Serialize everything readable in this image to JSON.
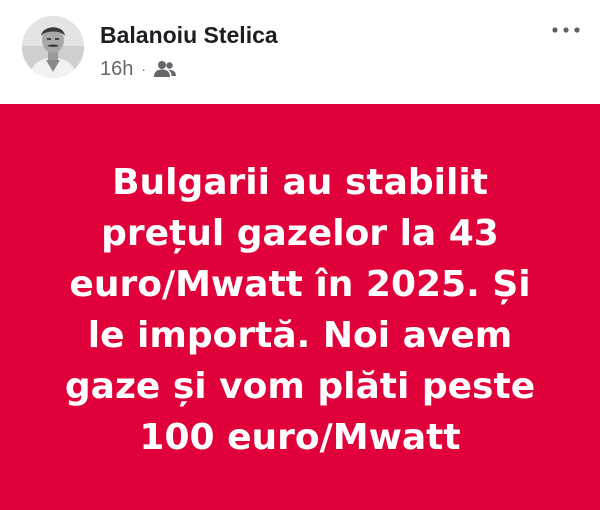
{
  "post": {
    "author": "Balanoiu Stelica",
    "time": "16h",
    "separator": "·",
    "audience_icon": "friends-icon",
    "more_icon": "more-horizontal-icon",
    "background_color": "#e0003a",
    "text_lines": [
      "Bulgarii au stabilit",
      "prețul gazelor la 43",
      "euro/Mwatt în 2025. Și",
      "le importă. Noi avem",
      "gaze și vom plăti peste",
      "100 euro/Mwatt"
    ]
  }
}
